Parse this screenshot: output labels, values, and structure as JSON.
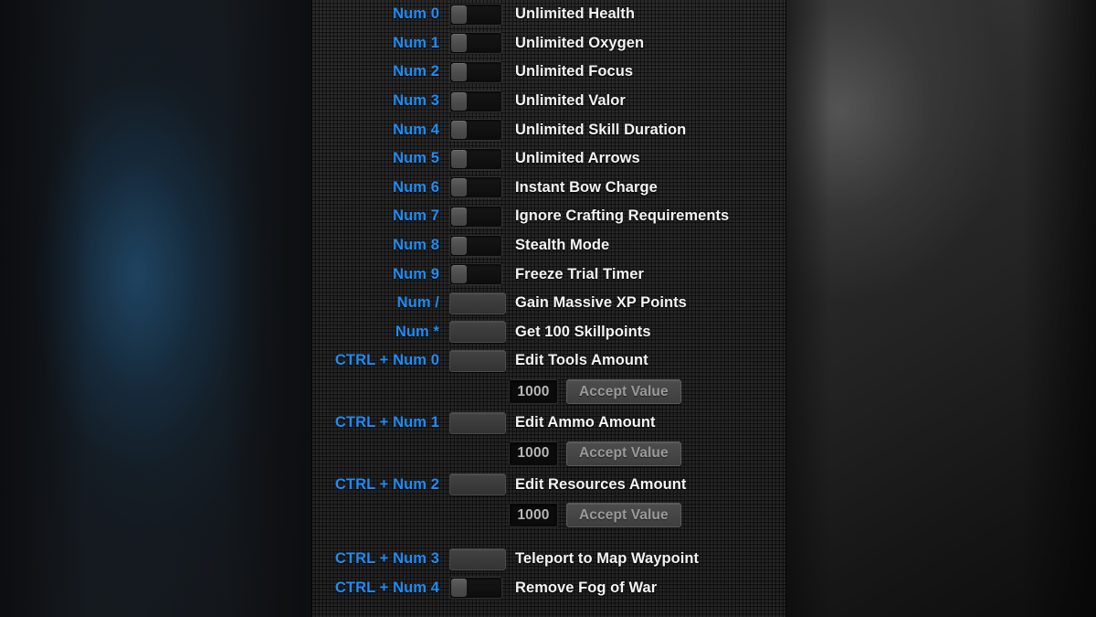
{
  "panel": {
    "accent_hotkey_color": "#1f8df5",
    "label_color": "#f4f4f4",
    "panel_bg_color": "#232323"
  },
  "value_editor": {
    "value": "1000",
    "accept_label": "Accept Value",
    "placeholder": "1000"
  },
  "rows": [
    {
      "hotkey": "Num 0",
      "label": "Unlimited Health",
      "control": "toggle"
    },
    {
      "hotkey": "Num 1",
      "label": "Unlimited Oxygen",
      "control": "toggle"
    },
    {
      "hotkey": "Num 2",
      "label": "Unlimited Focus",
      "control": "toggle"
    },
    {
      "hotkey": "Num 3",
      "label": "Unlimited Valor",
      "control": "toggle"
    },
    {
      "hotkey": "Num 4",
      "label": "Unlimited Skill Duration",
      "control": "toggle"
    },
    {
      "hotkey": "Num 5",
      "label": "Unlimited Arrows",
      "control": "toggle"
    },
    {
      "hotkey": "Num 6",
      "label": "Instant Bow Charge",
      "control": "toggle"
    },
    {
      "hotkey": "Num 7",
      "label": "Ignore Crafting Requirements",
      "control": "toggle"
    },
    {
      "hotkey": "Num 8",
      "label": "Stealth Mode",
      "control": "toggle"
    },
    {
      "hotkey": "Num 9",
      "label": "Freeze Trial Timer",
      "control": "toggle"
    },
    {
      "hotkey": "Num /",
      "label": "Gain Massive XP Points",
      "control": "button"
    },
    {
      "hotkey": "Num *",
      "label": "Get 100 Skillpoints",
      "control": "button"
    },
    {
      "hotkey": "CTRL + Num 0",
      "label": "Edit Tools Amount",
      "control": "button",
      "value_editor": true
    },
    {
      "hotkey": "CTRL + Num 1",
      "label": "Edit Ammo Amount",
      "control": "button",
      "value_editor": true
    },
    {
      "hotkey": "CTRL + Num 2",
      "label": "Edit Resources Amount",
      "control": "button",
      "value_editor": true,
      "gap_after": true
    },
    {
      "hotkey": "CTRL + Num 3",
      "label": "Teleport to Map Waypoint",
      "control": "button"
    },
    {
      "hotkey": "CTRL + Num 4",
      "label": "Remove Fog of War",
      "control": "toggle"
    }
  ]
}
